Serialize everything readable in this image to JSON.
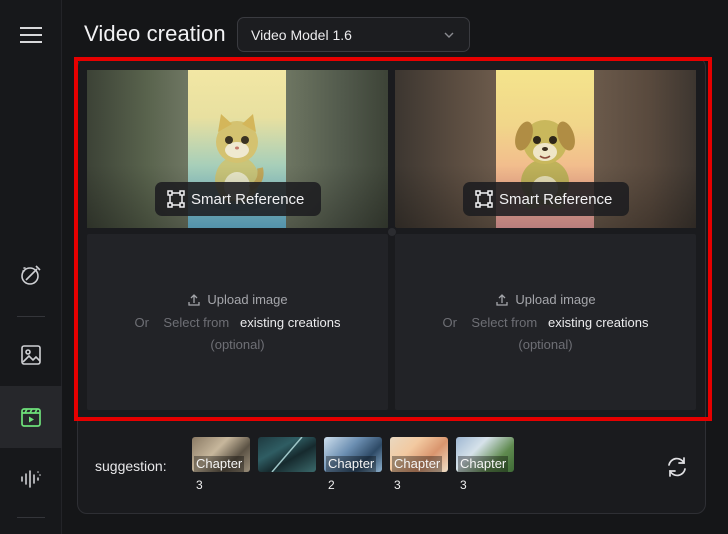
{
  "header": {
    "title": "Video creation",
    "model_select_value": "Video Model 1.6"
  },
  "sidebar": {
    "items": [
      {
        "icon": "menu-icon"
      },
      {
        "icon": "magic-brush-icon"
      },
      {
        "icon": "image-icon"
      },
      {
        "icon": "video-icon",
        "active": true
      },
      {
        "icon": "audio-wave-icon"
      }
    ]
  },
  "frames": [
    {
      "image": "cat-figure-image",
      "smart_reference_label": "Smart Reference",
      "upload_label": "Upload image",
      "or_text": "Or",
      "select_from_text": "Select from",
      "existing_creations_text": "existing creations",
      "optional_text": "(optional)"
    },
    {
      "image": "dog-figure-image",
      "smart_reference_label": "Smart Reference",
      "upload_label": "Upload image",
      "or_text": "Or",
      "select_from_text": "Select from",
      "existing_creations_text": "existing creations",
      "optional_text": "(optional)"
    }
  ],
  "suggestions": {
    "label": "suggestion:",
    "items": [
      {
        "caption": "Chapter",
        "number": "3"
      },
      {
        "caption": "",
        "number": ""
      },
      {
        "caption": "Chapter",
        "number": "2"
      },
      {
        "caption": "Chapter",
        "number": "3"
      },
      {
        "caption": "Chapter",
        "number": "3"
      }
    ]
  },
  "colors": {
    "highlight_frame": "#e60000",
    "active_icon": "#6ee07a",
    "background": "#151618"
  }
}
